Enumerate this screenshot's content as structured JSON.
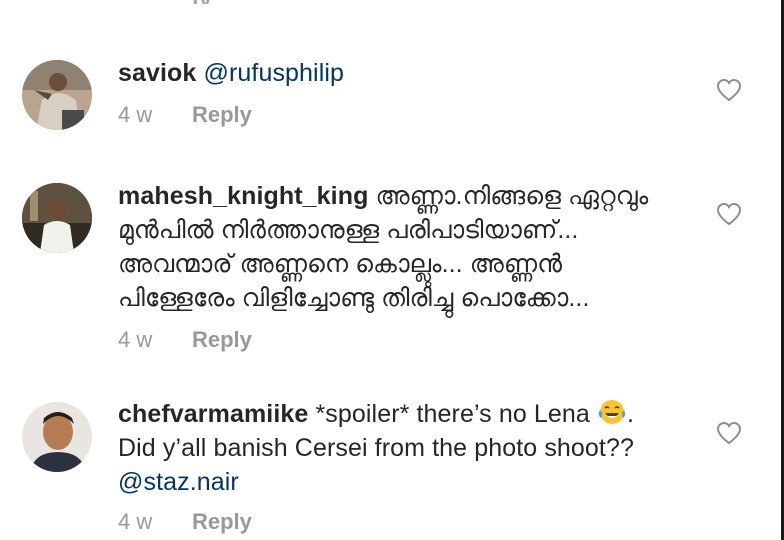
{
  "top_fragment": "ly",
  "comments": [
    {
      "username": "saviok",
      "mention": "@rufusphilip",
      "time": "4 w",
      "reply_label": "Reply"
    },
    {
      "username": "mahesh_knight_king",
      "text_line1": "അണ്ണാ.നിങ്ങളെ ഏറ്റവും",
      "text_line2": "മുൻപിൽ നിർത്താനുള്ള പരിപാടിയാണ്...",
      "text_line3": "അവന്മാര് അണ്ണനെ കൊല്ലും... അണ്ണൻ",
      "text_line4": "പിള്ളേരേം വിളിച്ചോണ്ടു തിരിച്ചു പൊക്കോ...",
      "time": "4 w",
      "reply_label": "Reply"
    },
    {
      "username": "chefvarmamiike",
      "text_part1": "*spoiler* there’s no Lena",
      "text_part2": ".",
      "text_line2": "Did y’all banish Cersei from the photo shoot??",
      "mention": "@staz.nair",
      "time": "4 w",
      "reply_label": "Reply"
    }
  ],
  "icons": {
    "like": "heart-outline-icon",
    "emoji": "face-with-tears-of-joy-icon"
  },
  "colors": {
    "text": "#262626",
    "mention": "#003569",
    "meta": "#999999",
    "heart": "#8e8e8e"
  }
}
